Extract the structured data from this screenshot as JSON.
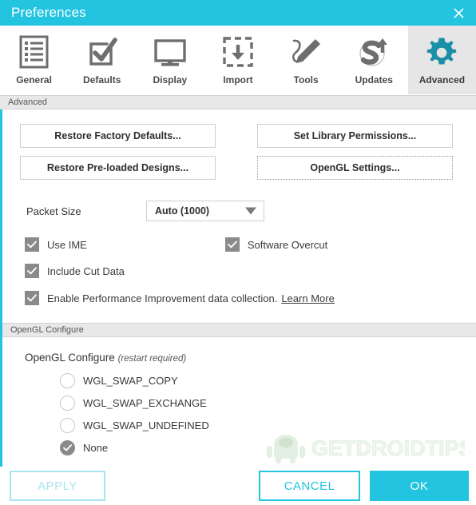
{
  "window": {
    "title": "Preferences",
    "close_icon": "close-icon",
    "accent_color": "#22c4e0",
    "accent_disabled_color": "#a9e4f1"
  },
  "tabs": [
    {
      "label": "General",
      "icon": "list-document-icon",
      "active": false
    },
    {
      "label": "Defaults",
      "icon": "checkbox-check-icon",
      "active": false
    },
    {
      "label": "Display",
      "icon": "monitor-icon",
      "active": false
    },
    {
      "label": "Import",
      "icon": "import-download-icon",
      "active": false
    },
    {
      "label": "Tools",
      "icon": "pencil-curve-icon",
      "active": false
    },
    {
      "label": "Updates",
      "icon": "s-update-arrow-icon",
      "active": false
    },
    {
      "label": "Advanced",
      "icon": "gear-icon",
      "active": true
    }
  ],
  "advanced": {
    "section_label": "Advanced",
    "buttons_left": [
      {
        "label": "Restore Factory Defaults...",
        "focused": false
      },
      {
        "label": "Restore Pre-loaded Designs...",
        "focused": false
      }
    ],
    "buttons_right": [
      {
        "label": "Set Library Permissions...",
        "focused": false
      },
      {
        "label": "OpenGL Settings...",
        "focused": true
      }
    ],
    "packet_size": {
      "label": "Packet Size",
      "value": "Auto (1000)",
      "caret_icon": "chevron-down-icon"
    },
    "checkboxes": [
      {
        "label": "Use IME",
        "checked": true
      },
      {
        "label": "Software Overcut",
        "checked": true
      },
      {
        "label": "Include Cut Data",
        "checked": true
      }
    ],
    "telemetry": {
      "label": "Enable Performance Improvement data collection.",
      "link": "Learn More",
      "checked": true
    }
  },
  "opengl": {
    "section_label": "OpenGL Configure",
    "title": "OpenGL Configure",
    "title_hint": "(restart required)",
    "options": [
      {
        "label": "WGL_SWAP_COPY",
        "selected": false
      },
      {
        "label": "WGL_SWAP_EXCHANGE",
        "selected": false
      },
      {
        "label": "WGL_SWAP_UNDEFINED",
        "selected": false
      },
      {
        "label": "None",
        "selected": true
      }
    ]
  },
  "watermark": {
    "text": "GETDROIDTIPS",
    "icon": "android-mascot-icon"
  },
  "footer": {
    "apply_label": "APPLY",
    "apply_enabled": false,
    "cancel_label": "CANCEL",
    "ok_label": "OK"
  }
}
